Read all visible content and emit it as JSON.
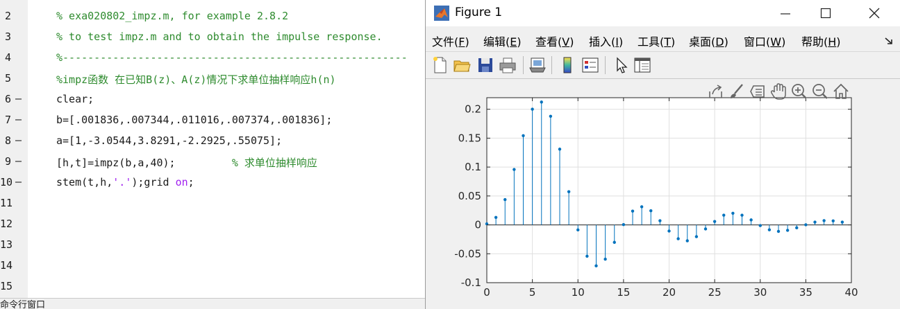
{
  "editor": {
    "lines": [
      {
        "num": "2",
        "dash": "",
        "segments": [
          {
            "text": "% exa020802_impz.m, for example 2.8.2",
            "cls": "cm"
          }
        ]
      },
      {
        "num": "3",
        "dash": "",
        "segments": [
          {
            "text": "% to test impz.m and to obtain the impulse response.",
            "cls": "cm"
          }
        ]
      },
      {
        "num": "4",
        "dash": "",
        "segments": [
          {
            "text": "%-------------------------------------------------------",
            "cls": "cm"
          }
        ]
      },
      {
        "num": "5",
        "dash": "",
        "segments": [
          {
            "text": "%impz函数 在已知B(z)、A(z)情况下求单位抽样响应h(n)",
            "cls": "cm"
          }
        ]
      },
      {
        "num": "6",
        "dash": "—",
        "segments": [
          {
            "text": "clear;",
            "cls": "kw"
          }
        ]
      },
      {
        "num": "7",
        "dash": "—",
        "segments": [
          {
            "text": "b=[.001836,.007344,.011016,.007374,.001836];",
            "cls": "kw"
          }
        ]
      },
      {
        "num": "8",
        "dash": "—",
        "segments": [
          {
            "text": "a=[1,-3.0544,3.8291,-2.2925,.55075];",
            "cls": "kw"
          }
        ]
      },
      {
        "num": "9",
        "dash": "—",
        "segments": [
          {
            "text": "[h,t]=impz(b,a,40);         ",
            "cls": "kw"
          },
          {
            "text": "% 求单位抽样响应",
            "cls": "cm"
          }
        ]
      },
      {
        "num": "10",
        "dash": "—",
        "segments": [
          {
            "text": "stem(t,h,",
            "cls": "kw"
          },
          {
            "text": "'.'",
            "cls": "str"
          },
          {
            "text": ");grid ",
            "cls": "kw"
          },
          {
            "text": "on",
            "cls": "str"
          },
          {
            "text": ";",
            "cls": "kw"
          }
        ]
      },
      {
        "num": "11",
        "dash": "",
        "segments": []
      },
      {
        "num": "12",
        "dash": "",
        "segments": []
      },
      {
        "num": "13",
        "dash": "",
        "segments": []
      },
      {
        "num": "14",
        "dash": "",
        "segments": []
      },
      {
        "num": "15",
        "dash": "",
        "segments": []
      }
    ],
    "command_window_label": "命令行窗口"
  },
  "figure": {
    "title": "Figure 1",
    "menu": [
      {
        "label": "文件",
        "key": "F"
      },
      {
        "label": "编辑",
        "key": "E"
      },
      {
        "label": "查看",
        "key": "V"
      },
      {
        "label": "插入",
        "key": "I"
      },
      {
        "label": "工具",
        "key": "T"
      },
      {
        "label": "桌面",
        "key": "D"
      },
      {
        "label": "窗口",
        "key": "W"
      },
      {
        "label": "帮助",
        "key": "H"
      }
    ],
    "toolbar_icons": [
      "new-figure-icon",
      "open-file-icon",
      "save-icon",
      "print-icon",
      "link-icon",
      "colorbar-icon",
      "legend-icon",
      "pointer-icon",
      "property-editor-icon"
    ],
    "axes_toolbar_icons": [
      "export-icon",
      "brush-icon",
      "data-tips-icon",
      "pan-icon",
      "zoom-in-icon",
      "zoom-out-icon",
      "home-icon"
    ],
    "colors": {
      "stem": "#0072bd",
      "grid": "#dfdfdf"
    }
  },
  "chart_data": {
    "type": "stem",
    "title": "",
    "xlabel": "",
    "ylabel": "",
    "xlim": [
      0,
      40
    ],
    "ylim": [
      -0.1,
      0.22
    ],
    "xticks": [
      0,
      5,
      10,
      15,
      20,
      25,
      30,
      35,
      40
    ],
    "yticks": [
      -0.1,
      -0.05,
      0,
      0.05,
      0.1,
      0.15,
      0.2
    ],
    "ytick_labels": [
      "-0.1",
      "-0.05",
      "0",
      "0.05",
      "0.1",
      "0.15",
      "0.2"
    ],
    "grid": true,
    "x": [
      0,
      1,
      2,
      3,
      4,
      5,
      6,
      7,
      8,
      9,
      10,
      11,
      12,
      13,
      14,
      15,
      16,
      17,
      18,
      19,
      20,
      21,
      22,
      23,
      24,
      25,
      26,
      27,
      28,
      29,
      30,
      31,
      32,
      33,
      34,
      35,
      36,
      37,
      38,
      39
    ],
    "values": [
      0.0018,
      0.0129,
      0.0437,
      0.0958,
      0.1543,
      0.2001,
      0.2125,
      0.1879,
      0.131,
      0.0574,
      -0.0087,
      -0.0542,
      -0.0709,
      -0.0593,
      -0.0302,
      0.0004,
      0.0238,
      0.0313,
      0.0244,
      0.0072,
      -0.0107,
      -0.024,
      -0.0275,
      -0.0204,
      -0.0071,
      0.0059,
      0.0168,
      0.0201,
      0.0167,
      0.0086,
      -0.0012,
      -0.0085,
      -0.0113,
      -0.0094,
      -0.0051,
      0.0001,
      0.0048,
      0.0074,
      0.0069,
      0.0048
    ]
  }
}
